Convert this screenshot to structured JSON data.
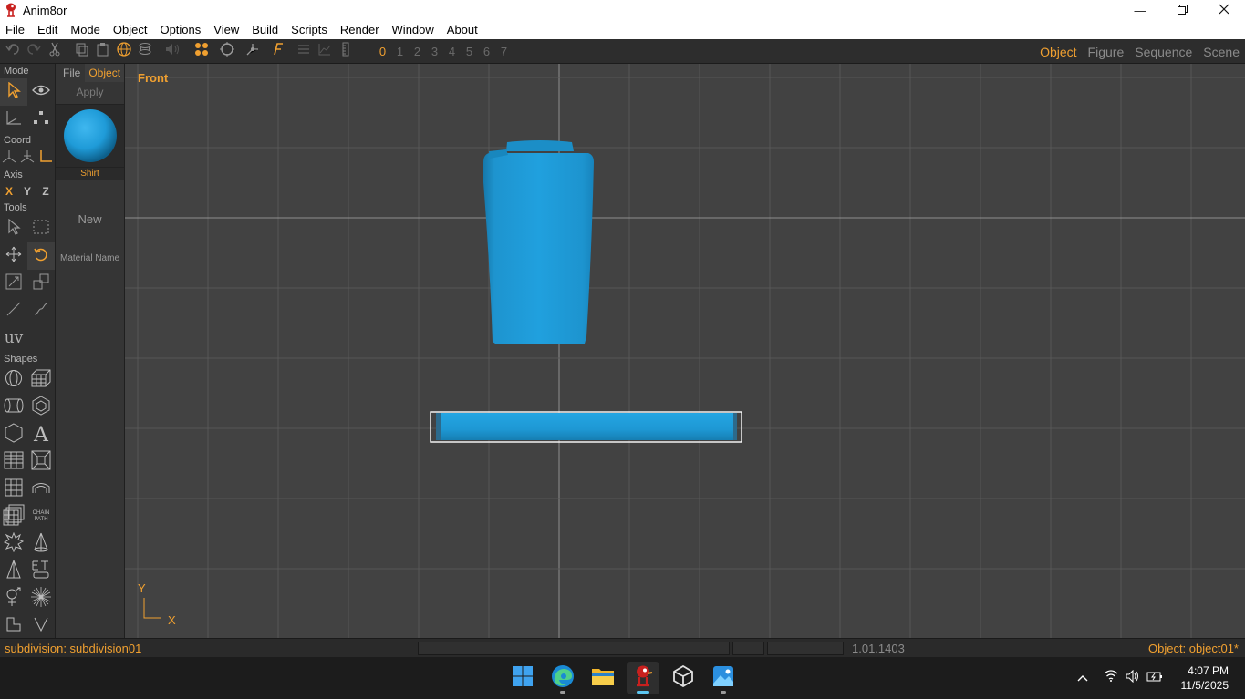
{
  "window": {
    "title": "Anim8or",
    "minimize_icon": "minimize-icon",
    "maximize_icon": "restore-icon",
    "close_icon": "close-icon"
  },
  "menu": {
    "items": [
      "File",
      "Edit",
      "Mode",
      "Object",
      "Options",
      "View",
      "Build",
      "Scripts",
      "Render",
      "Window",
      "About"
    ]
  },
  "toolbar": {
    "frames": [
      "0",
      "1",
      "2",
      "3",
      "4",
      "5",
      "6",
      "7"
    ],
    "active_frame": "0",
    "modes": [
      "Object",
      "Figure",
      "Sequence",
      "Scene"
    ],
    "active_mode": "Object"
  },
  "left_panel": {
    "mode_label": "Mode",
    "coord_label": "Coord",
    "axis_label": "Axis",
    "axes": [
      "X",
      "Y",
      "Z"
    ],
    "tools_label": "Tools",
    "uv_label": "uv",
    "shapes_label": "Shapes",
    "chain_path_label": "CHAIN PATH"
  },
  "material_panel": {
    "tabs": [
      "File",
      "Object"
    ],
    "active_tab": "Object",
    "apply_label": "Apply",
    "material_name": "Shirt",
    "new_label": "New",
    "material_name_label": "Material Name",
    "swatch_color": "#1e9ad6"
  },
  "viewport": {
    "view_label": "Front",
    "axis_y": "Y",
    "axis_x": "X",
    "grid_color": "#575757",
    "axis_line_color": "#8f8f8f",
    "object_color": "#1f9bd8"
  },
  "status": {
    "left": "subdivision: subdivision01",
    "version": "1.01.1403",
    "right": "Object: object01*"
  },
  "taskbar": {
    "time": "4:07 PM",
    "date": "11/5/2025"
  }
}
